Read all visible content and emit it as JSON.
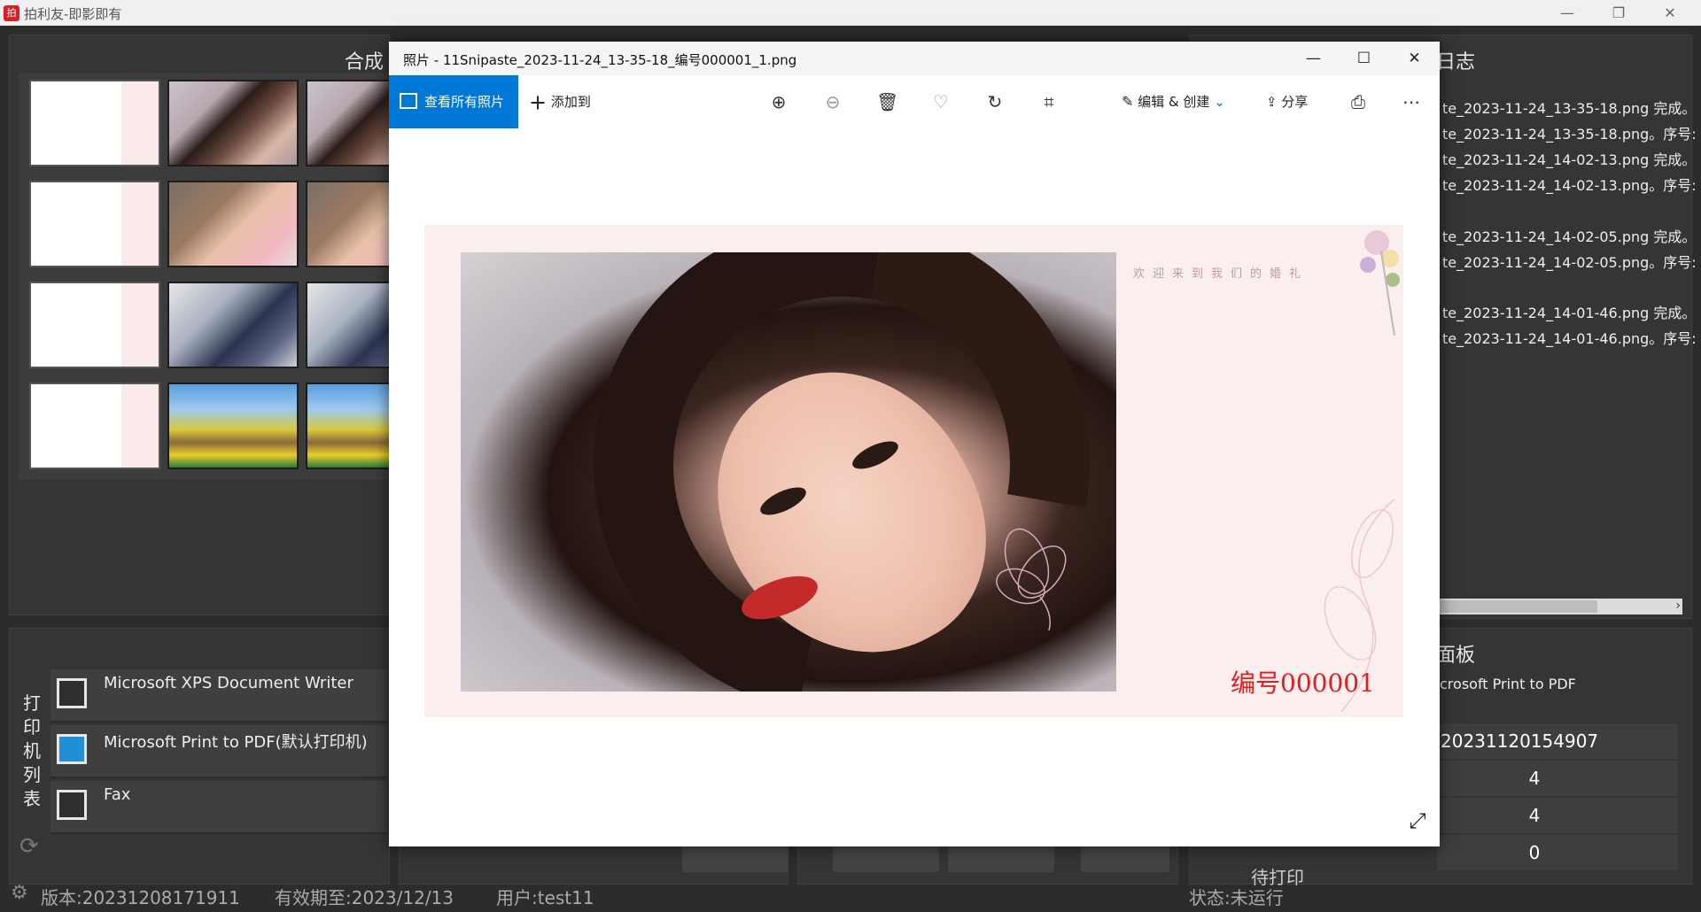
{
  "app": {
    "title": "拍利友-即影即有",
    "logo_text": "拍"
  },
  "window_controls": {
    "minimize": "—",
    "restore": "❐",
    "close": "✕"
  },
  "left_panel": {
    "title": "合成"
  },
  "right_panel": {
    "title": "日志",
    "log_lines": [
      "te_2023-11-24_13-35-18.png 完成。",
      "te_2023-11-24_13-35-18.png。序号:",
      "te_2023-11-24_14-02-13.png 完成。",
      "te_2023-11-24_14-02-13.png。序号:",
      "te_2023-11-24_14-02-05.png 完成。",
      "te_2023-11-24_14-02-05.png。序号:",
      "te_2023-11-24_14-01-46.png 完成。",
      "te_2023-11-24_14-01-46.png。序号:"
    ]
  },
  "printers": {
    "vertical_label": [
      "打",
      "印",
      "机",
      "列",
      "表"
    ],
    "items": [
      {
        "name": "Microsoft XPS Document Writer",
        "checked": false
      },
      {
        "name": "Microsoft Print to PDF(默认打印机)",
        "checked": true
      },
      {
        "name": "Fax",
        "checked": false
      }
    ]
  },
  "control_panel": {
    "title": "面板",
    "printer": "crosoft Print to PDF",
    "batch": "20231120154907",
    "count_a": "4",
    "count_b": "4",
    "pending_label": "待打印",
    "pending": "0"
  },
  "status": {
    "version": "版本:20231208171911",
    "valid_until": "有效期至:2023/12/13",
    "user": "用户:test11",
    "state": "状态:未运行"
  },
  "photos_window": {
    "title": "照片 - 11Snipaste_2023-11-24_13-35-18_编号000001_1.png",
    "view_all": "查看所有照片",
    "add_to": "添加到",
    "edit_create": "编辑 & 创建",
    "share": "分享",
    "icons": [
      "zoom-in-icon",
      "zoom-out-icon",
      "delete-icon",
      "heart-icon",
      "rotate-icon",
      "crop-icon",
      "print-icon",
      "more-icon"
    ]
  },
  "photo_card": {
    "welcome_text": "欢迎来到我们的婚礼",
    "serial_text": "编号000001"
  }
}
